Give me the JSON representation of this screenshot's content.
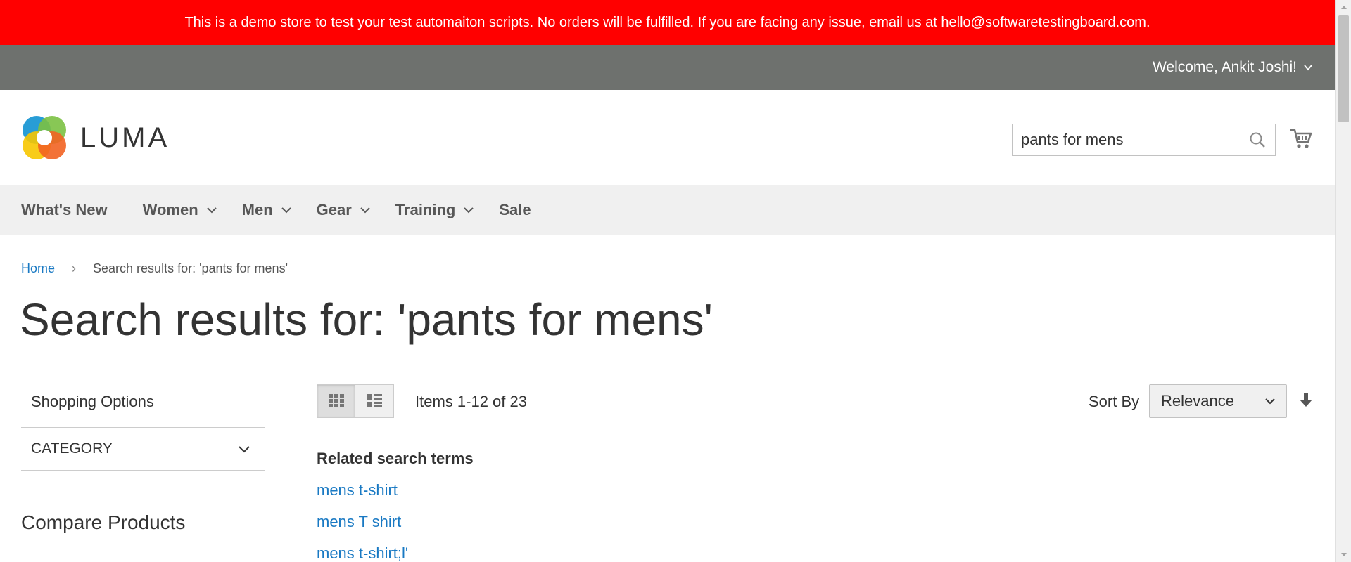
{
  "banner": {
    "text": "This is a demo store to test your test automaiton scripts. No orders will be fulfilled. If you are facing any issue, email us at hello@softwaretestingboard.com."
  },
  "top_bar": {
    "welcome": "Welcome, Ankit Joshi!"
  },
  "header": {
    "logo_text": "LUMA",
    "search": {
      "value": "pants for mens"
    },
    "icons": {
      "search": "search-icon",
      "cart": "cart-icon"
    }
  },
  "nav": {
    "items": [
      {
        "label": "What's New",
        "has_dropdown": false
      },
      {
        "label": "Women",
        "has_dropdown": true
      },
      {
        "label": "Men",
        "has_dropdown": true
      },
      {
        "label": "Gear",
        "has_dropdown": true
      },
      {
        "label": "Training",
        "has_dropdown": true
      },
      {
        "label": "Sale",
        "has_dropdown": false
      }
    ]
  },
  "breadcrumb": {
    "home": "Home",
    "current": "Search results for: 'pants for mens'"
  },
  "page_title": "Search results for: 'pants for mens'",
  "sidebar": {
    "shopping_options": "Shopping Options",
    "filter_category": "CATEGORY",
    "compare_title": "Compare Products"
  },
  "toolbar": {
    "view_modes": [
      "grid",
      "list"
    ],
    "active_mode": "grid",
    "items_count": "Items 1-12 of 23",
    "sort_label": "Sort By",
    "sort_selected": "Relevance",
    "sort_direction": "descending"
  },
  "related": {
    "title": "Related search terms",
    "terms": [
      "mens t-shirt",
      "mens T shirt",
      "mens t-shirt;l'"
    ]
  },
  "colors": {
    "banner_bg": "#ff0000",
    "top_bar_bg": "#6e716e",
    "nav_bg": "#f0f0f0",
    "link": "#1979c3"
  }
}
